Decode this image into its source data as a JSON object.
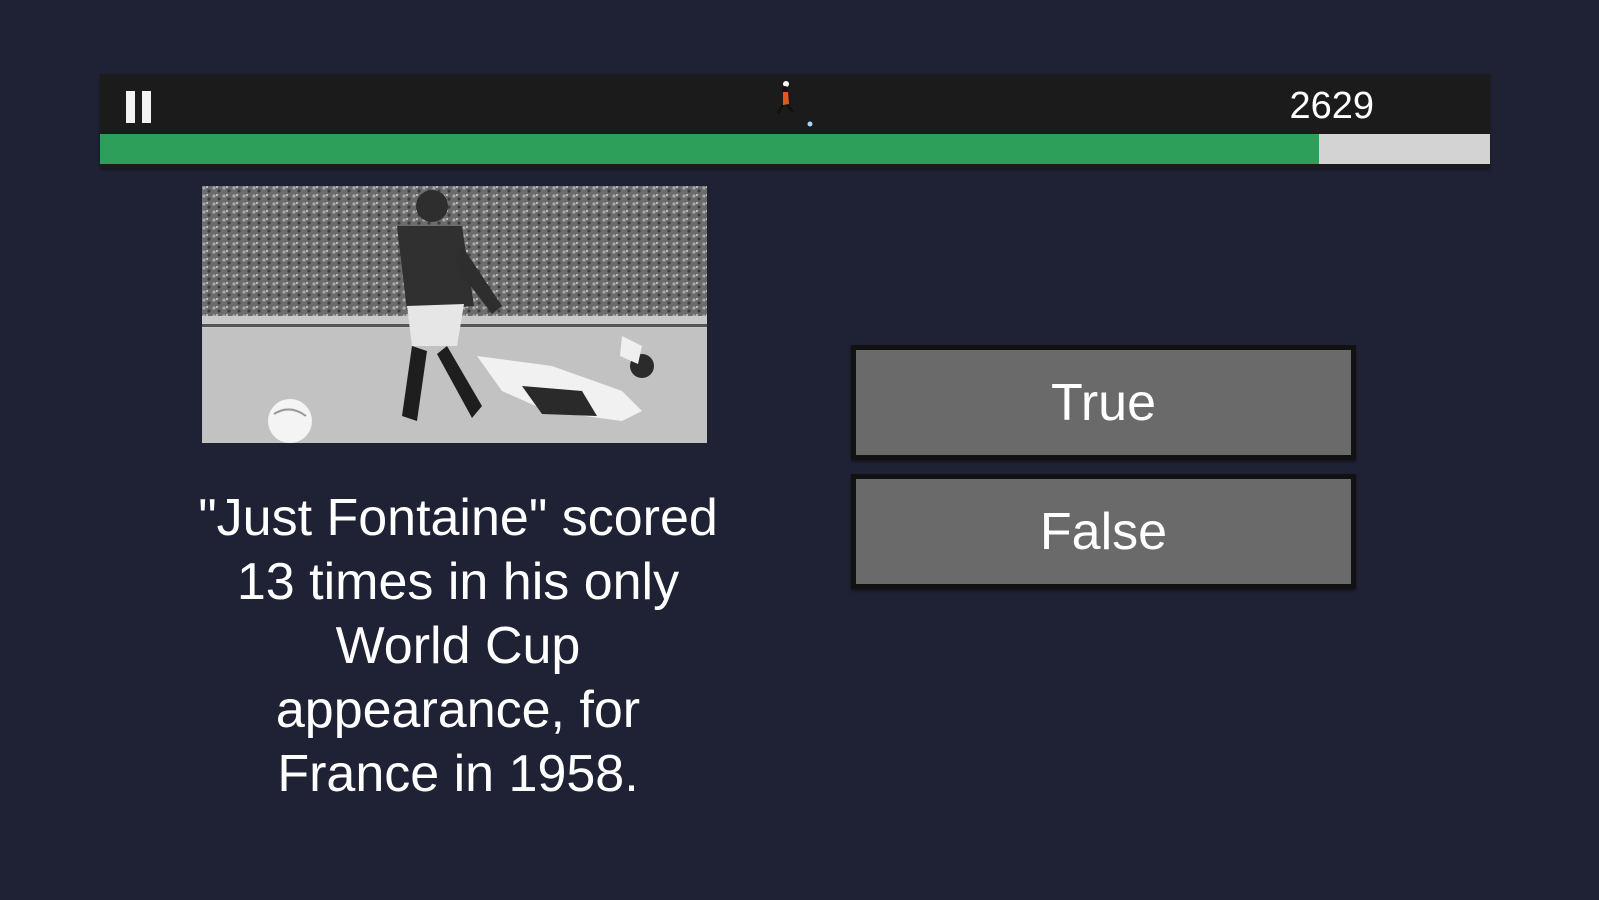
{
  "hud": {
    "score": "2629",
    "progress_fraction": 0.877,
    "pause_icon": "pause-icon",
    "player_icon": "running-player-icon",
    "colors": {
      "progress_fill": "#2e9e5b",
      "progress_track": "#d3d3d3",
      "hud_background": "#1b1b1b"
    }
  },
  "question": {
    "image_icon": "black-and-white-football-photo",
    "text": "\"Just Fontaine\" scored 13 times in his only World Cup appearance, for France in 1958."
  },
  "answers": {
    "true_label": "True",
    "false_label": "False"
  },
  "colors": {
    "background": "#1f2235",
    "button_fill": "#6a6a6a"
  }
}
